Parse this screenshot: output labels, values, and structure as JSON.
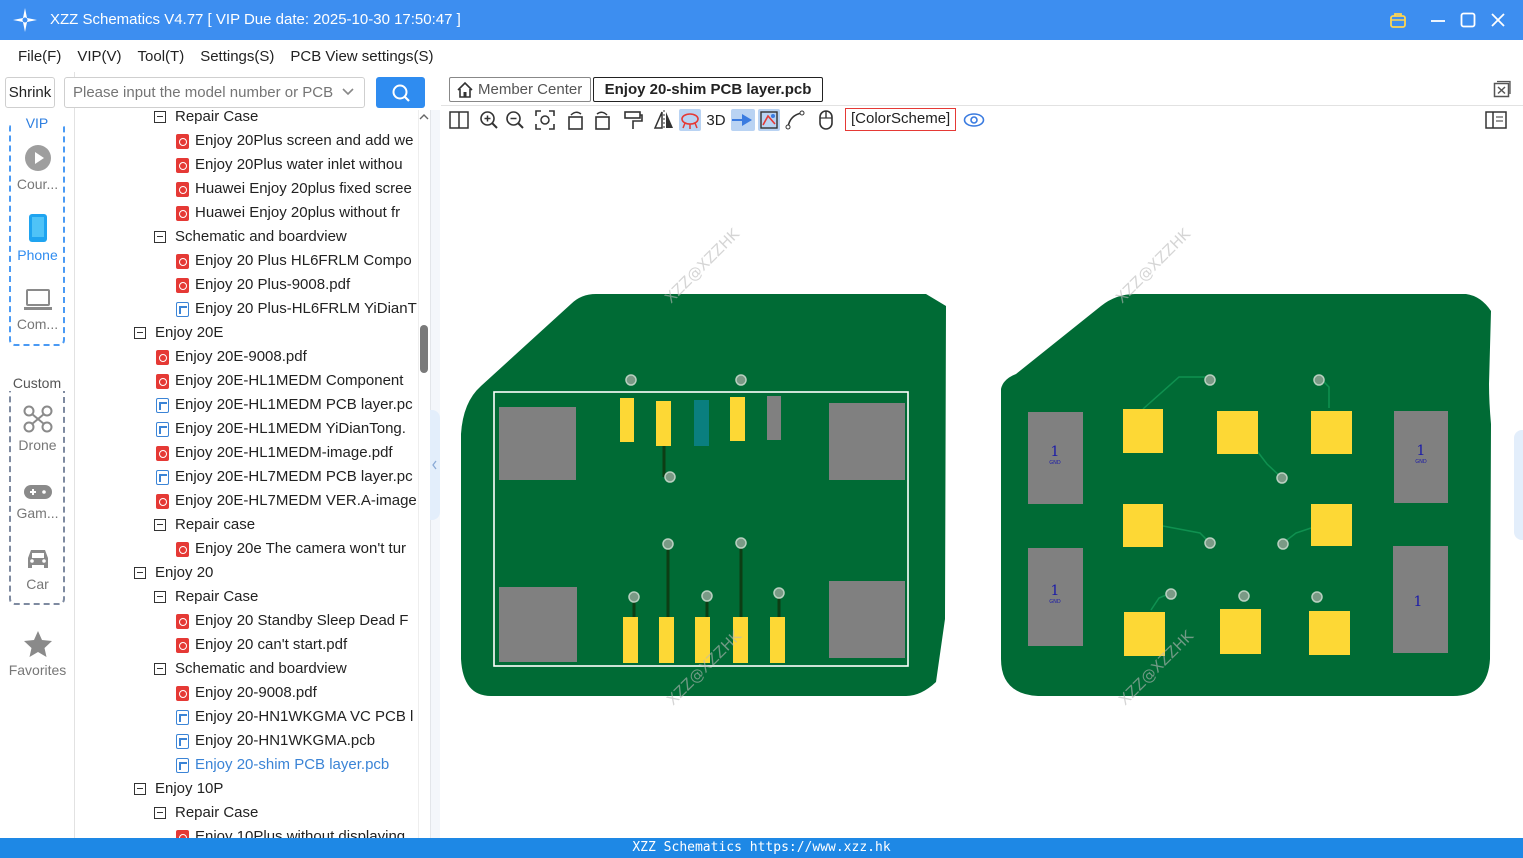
{
  "app": {
    "title": "XZZ Schematics V4.77 [ VIP Due date: 2025-10-30 17:50:47 ]",
    "accent": "#3d8ef0"
  },
  "menu": [
    "File(F)",
    "VIP(V)",
    "Tool(T)",
    "Settings(S)",
    "PCB View settings(S)"
  ],
  "search": {
    "shrink_label": "Shrink",
    "placeholder": "Please input the model number or PCB"
  },
  "rail": {
    "vip_title": "VIP",
    "vip_items": [
      "Cour...",
      "Phone",
      "Com..."
    ],
    "custom_title": "Custom",
    "custom_items": [
      "Drone",
      "Gam...",
      "Car"
    ],
    "favorites": "Favorites"
  },
  "tree": [
    {
      "level": 2,
      "type": "folder",
      "label": "Repair Case"
    },
    {
      "level": 3,
      "type": "pdf",
      "label": "Enjoy 20Plus screen and add we"
    },
    {
      "level": 3,
      "type": "pdf",
      "label": "Enjoy 20Plus water inlet withou"
    },
    {
      "level": 3,
      "type": "pdf",
      "label": "Huawei Enjoy 20plus fixed scree"
    },
    {
      "level": 3,
      "type": "pdf",
      "label": "Huawei Enjoy 20plus without fr"
    },
    {
      "level": 2,
      "type": "folder",
      "label": "Schematic and boardview"
    },
    {
      "level": 3,
      "type": "pdf",
      "label": "Enjoy 20 Plus HL6FRLM Compo"
    },
    {
      "level": 3,
      "type": "pdf",
      "label": "Enjoy 20 Plus-9008.pdf"
    },
    {
      "level": 3,
      "type": "pcb",
      "label": "Enjoy 20 Plus-HL6FRLM YiDianT"
    },
    {
      "level": 1,
      "type": "folder",
      "label": "Enjoy 20E"
    },
    {
      "level": 2,
      "type": "pdf",
      "label": "Enjoy 20E-9008.pdf"
    },
    {
      "level": 2,
      "type": "pdf",
      "label": "Enjoy 20E-HL1MEDM Component"
    },
    {
      "level": 2,
      "type": "pcb",
      "label": "Enjoy 20E-HL1MEDM PCB layer.pc"
    },
    {
      "level": 2,
      "type": "pcb",
      "label": "Enjoy 20E-HL1MEDM YiDianTong."
    },
    {
      "level": 2,
      "type": "pdf",
      "label": "Enjoy 20E-HL1MEDM-image.pdf"
    },
    {
      "level": 2,
      "type": "pcb",
      "label": "Enjoy 20E-HL7MEDM PCB layer.pc"
    },
    {
      "level": 2,
      "type": "pdf",
      "label": "Enjoy 20E-HL7MEDM VER.A-image"
    },
    {
      "level": 2,
      "type": "folder",
      "label": "Repair case"
    },
    {
      "level": 3,
      "type": "pdf",
      "label": "Enjoy 20e The camera won't tur"
    },
    {
      "level": 1,
      "type": "folder",
      "label": "Enjoy 20"
    },
    {
      "level": 2,
      "type": "folder",
      "label": "Repair Case"
    },
    {
      "level": 3,
      "type": "pdf",
      "label": "Enjoy 20 Standby Sleep Dead F"
    },
    {
      "level": 3,
      "type": "pdf",
      "label": "Enjoy 20 can't start.pdf"
    },
    {
      "level": 2,
      "type": "folder",
      "label": "Schematic and boardview"
    },
    {
      "level": 3,
      "type": "pdf",
      "label": "Enjoy 20-9008.pdf"
    },
    {
      "level": 3,
      "type": "pcb",
      "label": "Enjoy 20-HN1WKGMA VC PCB l"
    },
    {
      "level": 3,
      "type": "pcb",
      "label": "Enjoy 20-HN1WKGMA.pcb"
    },
    {
      "level": 3,
      "type": "pcb",
      "label": "Enjoy 20-shim PCB layer.pcb",
      "selected": true
    },
    {
      "level": 1,
      "type": "folder",
      "label": "Enjoy 10P"
    },
    {
      "level": 2,
      "type": "folder",
      "label": "Repair Case"
    },
    {
      "level": 3,
      "type": "pdf",
      "label": "Enjoy 10Plus without displaying"
    }
  ],
  "tabs": {
    "member_center": "Member Center",
    "active_file": "Enjoy 20-shim PCB layer.pcb"
  },
  "toolbar": {
    "label_3d": "3D",
    "color_scheme": "[ColorScheme]"
  },
  "pcb": {
    "watermark": "XZZ@XZZHK",
    "pad_label": "1",
    "net_label": "GND",
    "board_color": "#006b35",
    "pad_color": "#fdd835",
    "gray_pad_color": "#808080"
  },
  "status": "XZZ Schematics https://www.xzz.hk"
}
